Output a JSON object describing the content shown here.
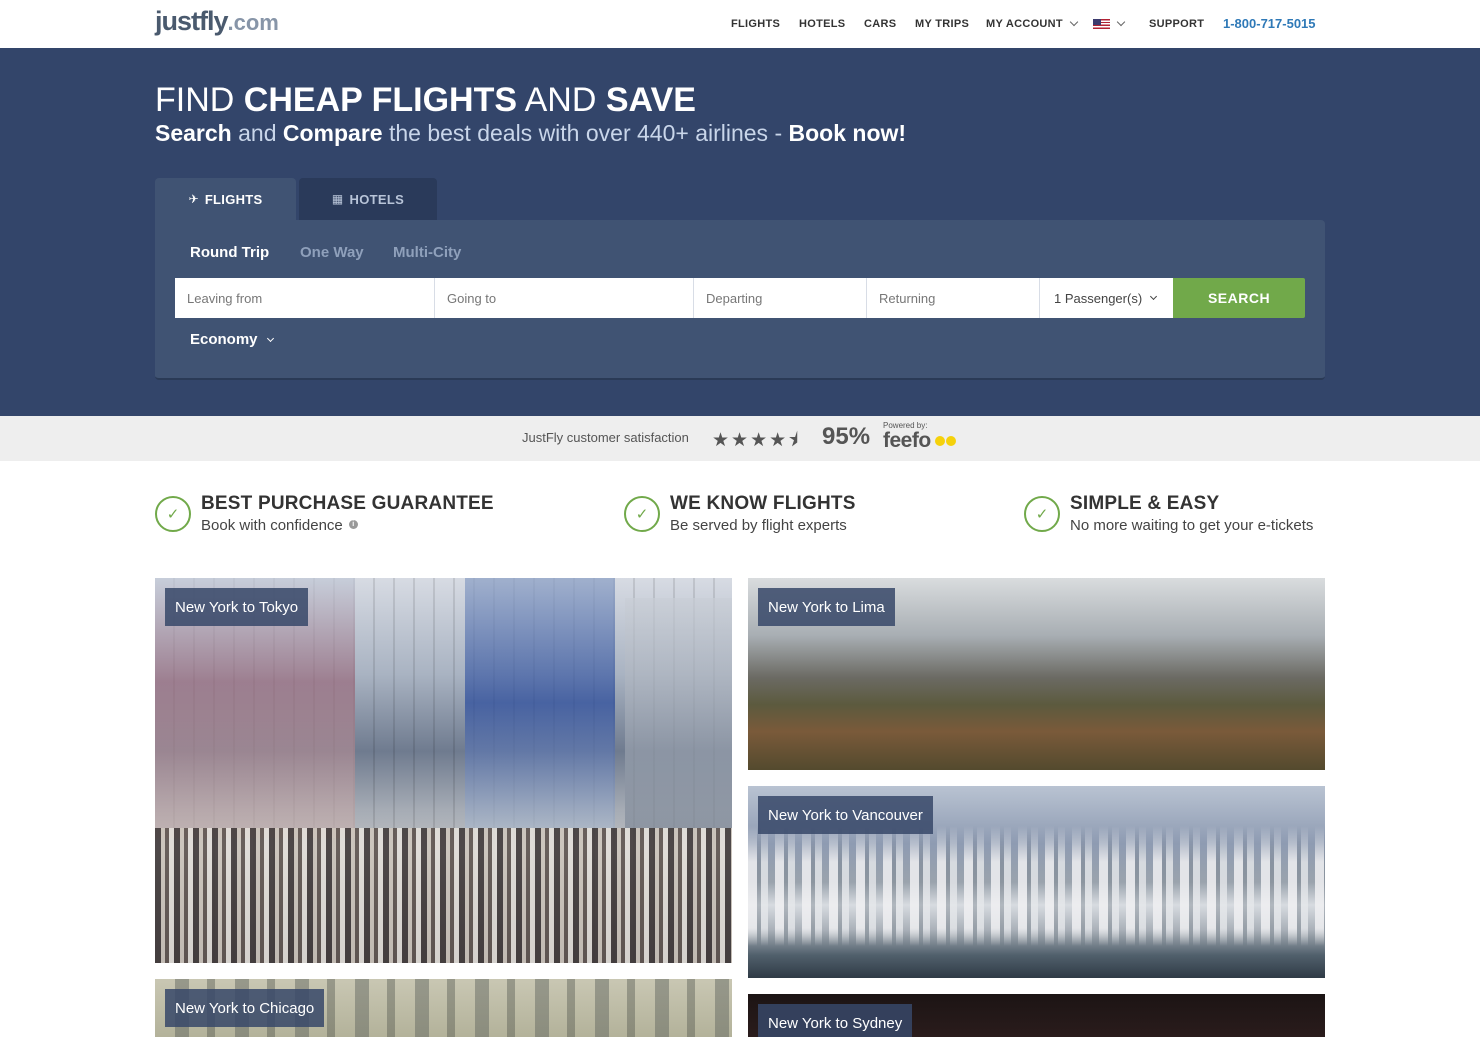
{
  "logo": {
    "brand": "justfly",
    "tld": ".com"
  },
  "nav": {
    "items": [
      "FLIGHTS",
      "HOTELS",
      "CARS",
      "MY TRIPS",
      "MY ACCOUNT",
      "SUPPORT"
    ],
    "phone": "1-800-717-5015",
    "locale_icon": "us-flag-icon"
  },
  "hero": {
    "headline": {
      "part1": "FIND ",
      "part2": "CHEAP FLIGHTS",
      "part3": " AND ",
      "part4": "SAVE"
    },
    "subhead": {
      "search": "Search",
      "and": " and ",
      "compare": "Compare",
      "rest": " the best deals with over 440+ airlines - ",
      "book": "Book now!"
    }
  },
  "search": {
    "tabs": [
      "FLIGHTS",
      "HOTELS"
    ],
    "trip_types": [
      "Round Trip",
      "One Way",
      "Multi-City"
    ],
    "selected_trip_type": "Round Trip",
    "fields": {
      "leaving_placeholder": "Leaving from",
      "going_placeholder": "Going to",
      "departing_placeholder": "Departing",
      "returning_placeholder": "Returning",
      "passengers": "1 Passenger(s)"
    },
    "search_button": "SEARCH",
    "cabin_class": "Economy"
  },
  "satisfaction": {
    "label": "JustFly customer satisfaction",
    "stars": "★★★★",
    "half_star": "⯨",
    "rating_stars": 4.5,
    "percent": "95%",
    "powered_by": "Powered by:",
    "provider": "feefo"
  },
  "features": [
    {
      "title": "BEST PURCHASE GUARANTEE",
      "subtitle": "Book with confidence"
    },
    {
      "title": "WE KNOW FLIGHTS",
      "subtitle": "Be served by flight experts"
    },
    {
      "title": "SIMPLE & EASY",
      "subtitle": "No more waiting to get your e-tickets"
    }
  ],
  "destinations": [
    {
      "label": "New York to Tokyo"
    },
    {
      "label": "New York to Lima"
    },
    {
      "label": "New York to Vancouver"
    },
    {
      "label": "New York to Chicago"
    },
    {
      "label": "New York to Sydney"
    }
  ],
  "colors": {
    "hero_bg": "#33456a",
    "panel_bg": "#405373",
    "accent_green": "#71a94a",
    "phone_blue": "#2f79b7"
  }
}
